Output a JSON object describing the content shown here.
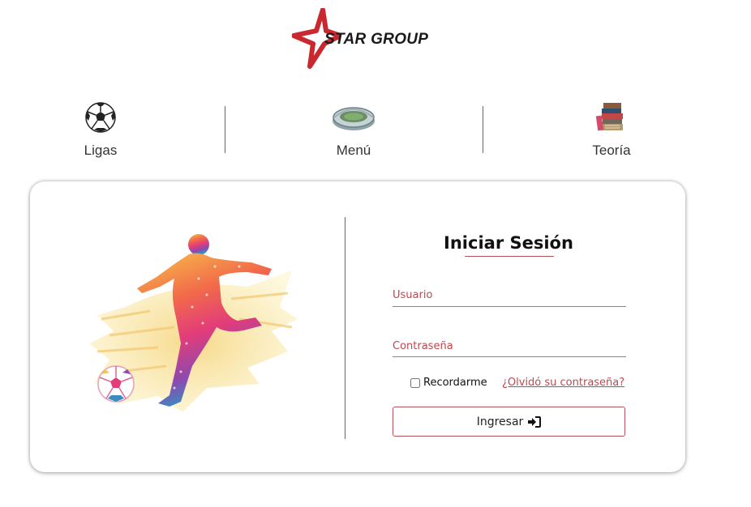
{
  "brand": {
    "name": "STAR GROUP",
    "star_color": "#c8282e"
  },
  "nav": {
    "items": [
      {
        "label": "Ligas",
        "icon": "soccer-ball-icon"
      },
      {
        "label": "Menú",
        "icon": "stadium-icon"
      },
      {
        "label": "Teoría",
        "icon": "books-icon"
      }
    ],
    "separator_color": "#a84a4f"
  },
  "login": {
    "title": "Iniciar Sesión",
    "username_placeholder": "Usuario",
    "password_placeholder": "Contraseña",
    "remember_label": "Recordarme",
    "forgot_link": "¿Olvidó su contraseña?",
    "submit_label": "Ingresar",
    "submit_icon": "sign-in-icon",
    "accent_color": "#c0484f"
  },
  "illustration": {
    "icon": "soccer-player-illustration"
  }
}
